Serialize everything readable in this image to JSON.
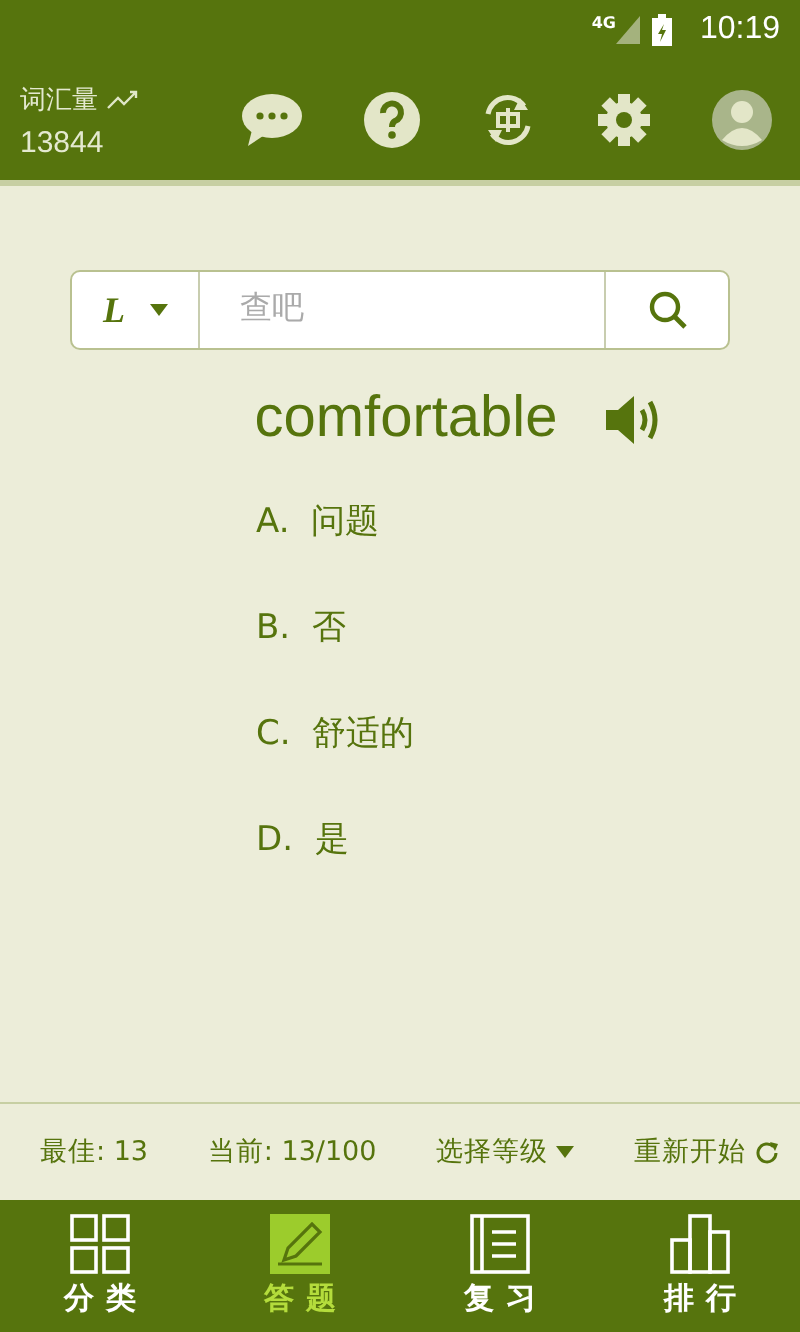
{
  "status_bar": {
    "network": "4G",
    "time": "10:19"
  },
  "header": {
    "vocab_label": "词汇量",
    "vocab_count": "13844"
  },
  "search": {
    "lang": "L",
    "placeholder": "查吧"
  },
  "word": "comfortable",
  "options": [
    {
      "letter": "A.",
      "text": "问题"
    },
    {
      "letter": "B.",
      "text": "否"
    },
    {
      "letter": "C.",
      "text": "舒适的"
    },
    {
      "letter": "D.",
      "text": "是"
    }
  ],
  "stats": {
    "best": "最佳: 13",
    "current": "当前: 13/100",
    "level": "选择等级",
    "restart": "重新开始"
  },
  "nav": [
    {
      "kind": "grid",
      "label": "分类",
      "selected": false
    },
    {
      "kind": "pencil",
      "label": "答题",
      "selected": true
    },
    {
      "kind": "book",
      "label": "复习",
      "selected": false
    },
    {
      "kind": "rank",
      "label": "排行",
      "selected": false
    }
  ]
}
